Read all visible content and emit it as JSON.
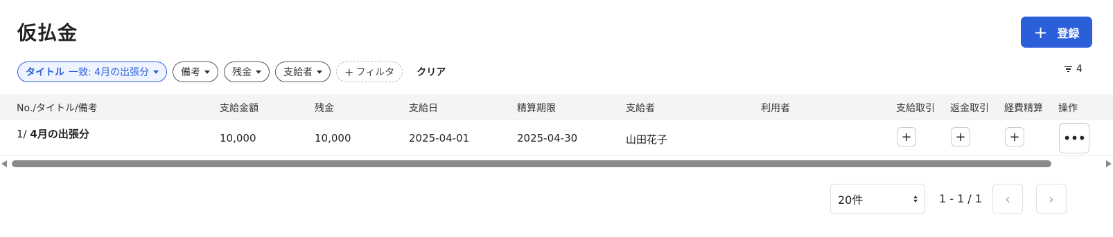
{
  "page_title": "仮払金",
  "register_button": {
    "icon": "plus-icon",
    "label": "登録"
  },
  "filters": {
    "active": {
      "key": "タイトル",
      "value": "一致: 4月の出張分"
    },
    "chips": [
      "備考",
      "残金",
      "支給者"
    ],
    "add_filter_label": "フィルタ",
    "clear_label": "クリア",
    "filter_count": "4"
  },
  "table": {
    "columns": [
      "No./タイトル/備考",
      "支給金額",
      "残金",
      "支給日",
      "精算期限",
      "支給者",
      "利用者",
      "支給取引",
      "返金取引",
      "経費精算",
      "操作"
    ],
    "rows": [
      {
        "no": "1/",
        "title": "4月の出張分",
        "amount": "10,000",
        "balance": "10,000",
        "pay_date": "2025-04-01",
        "deadline": "2025-04-30",
        "payer": "山田花子",
        "user": "",
        "payment_action": "+",
        "refund_action": "+",
        "expense_action": "+",
        "more_action": "•••"
      }
    ]
  },
  "pagination": {
    "page_size": "20件",
    "range": "1 - 1 / 1",
    "prev": "‹",
    "next": "›"
  },
  "colors": {
    "accent": "#2b5fd9",
    "header_bg": "#f4f4f4",
    "scroll_thumb": "#8a8a8a"
  }
}
